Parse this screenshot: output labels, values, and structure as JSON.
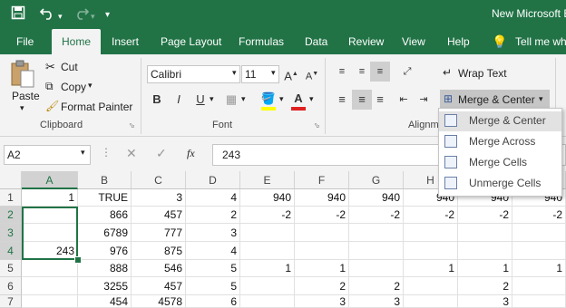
{
  "title_bar": {
    "doc_title": "New Microsoft E",
    "save_icon": "save-icon",
    "undo_icon": "undo-icon",
    "redo_icon": "redo-icon",
    "customize_icon": "customize-qat-icon"
  },
  "tabs": [
    {
      "label": "File"
    },
    {
      "label": "Home"
    },
    {
      "label": "Insert"
    },
    {
      "label": "Page Layout"
    },
    {
      "label": "Formulas"
    },
    {
      "label": "Data"
    },
    {
      "label": "Review"
    },
    {
      "label": "View"
    },
    {
      "label": "Help"
    },
    {
      "label": "Tell me wha"
    }
  ],
  "ribbon": {
    "clipboard": {
      "paste": "Paste",
      "cut": "Cut",
      "copy": "Copy",
      "format_painter": "Format Painter",
      "group_label": "Clipboard"
    },
    "font": {
      "font_name": "Calibri",
      "font_size": "11",
      "bold": "B",
      "italic": "I",
      "underline": "U",
      "group_label": "Font"
    },
    "alignment": {
      "wrap_text": "Wrap Text",
      "merge_center": "Merge & Center",
      "group_label": "Alignm"
    }
  },
  "merge_menu": {
    "items": [
      {
        "label": "Merge & Center"
      },
      {
        "label": "Merge Across"
      },
      {
        "label": "Merge Cells"
      },
      {
        "label": "Unmerge Cells"
      }
    ]
  },
  "formula_bar": {
    "name_box": "A2",
    "fx": "fx",
    "formula": "243"
  },
  "grid": {
    "columns": [
      "A",
      "B",
      "C",
      "D",
      "E",
      "F",
      "G",
      "H",
      "I",
      "J"
    ],
    "rows": [
      "1",
      "2",
      "3",
      "4",
      "5",
      "6",
      "7"
    ],
    "cells": [
      [
        "1",
        "TRUE",
        "3",
        "4",
        "940",
        "940",
        "940",
        "940",
        "940",
        "940"
      ],
      [
        "",
        "866",
        "457",
        "2",
        "-2",
        "-2",
        "-2",
        "-2",
        "-2",
        "-2"
      ],
      [
        "",
        "6789",
        "777",
        "3",
        "",
        "",
        "",
        "",
        "",
        ""
      ],
      [
        "243",
        "976",
        "875",
        "4",
        "",
        "",
        "",
        "",
        "",
        ""
      ],
      [
        "",
        "888",
        "546",
        "5",
        "1",
        "1",
        "",
        "1",
        "1",
        "1"
      ],
      [
        "",
        "3255",
        "457",
        "5",
        "",
        "2",
        "2",
        "",
        "2",
        ""
      ],
      [
        "",
        "454",
        "4578",
        "6",
        "",
        "3",
        "3",
        "",
        "3",
        ""
      ]
    ]
  }
}
